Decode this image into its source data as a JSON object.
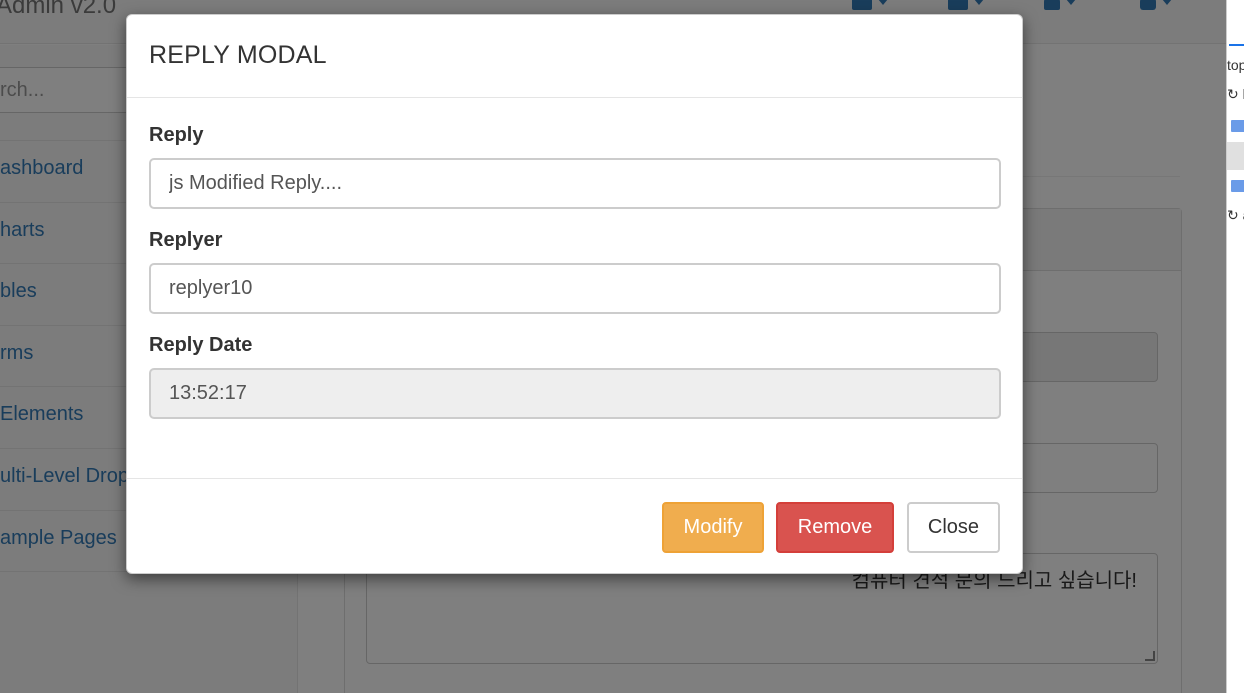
{
  "navbar": {
    "brand": "Admin v2.0"
  },
  "sidebar": {
    "search_placeholder": "rch...",
    "items": [
      {
        "label": "ashboard"
      },
      {
        "label": "harts"
      },
      {
        "label": "bles"
      },
      {
        "label": "rms"
      },
      {
        "label": " Elements"
      },
      {
        "label": "ulti-Level Drop"
      },
      {
        "label": "ample Pages"
      }
    ]
  },
  "background": {
    "textarea_text": "컴퓨터 견적 문의 드리고 싶습니다!"
  },
  "devtools": {
    "rows": [
      "top",
      "↻ l",
      "↻ a"
    ]
  },
  "modal": {
    "title": "REPLY MODAL",
    "fields": {
      "reply": {
        "label": "Reply",
        "value": "js Modified Reply...."
      },
      "replyer": {
        "label": "Replyer",
        "value": "replyer10"
      },
      "reply_date": {
        "label": "Reply Date",
        "value": "13:52:17"
      }
    },
    "buttons": {
      "modify": "Modify",
      "remove": "Remove",
      "close": "Close"
    }
  },
  "colors": {
    "warning": "#f0ad4e",
    "danger": "#d9534f",
    "link": "#337ab7"
  }
}
